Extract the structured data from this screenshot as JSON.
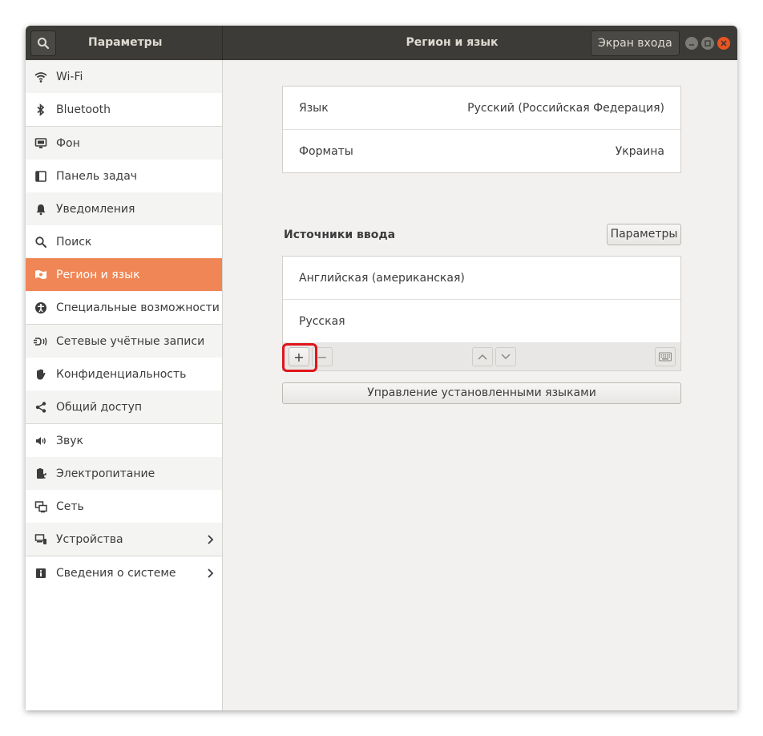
{
  "header": {
    "left_title": "Параметры",
    "center_title": "Регион и язык",
    "login_screen_button": "Экран входа"
  },
  "sidebar": {
    "items": [
      {
        "label": "Wi-Fi",
        "icon": "wifi-icon"
      },
      {
        "label": "Bluetooth",
        "icon": "bluetooth-icon"
      },
      {
        "label": "Фон",
        "icon": "background-icon"
      },
      {
        "label": "Панель задач",
        "icon": "dock-icon"
      },
      {
        "label": "Уведомления",
        "icon": "bell-icon"
      },
      {
        "label": "Поиск",
        "icon": "search-icon"
      },
      {
        "label": "Регион и язык",
        "icon": "region-flag-icon",
        "active": true
      },
      {
        "label": "Специальные возможности",
        "icon": "accessibility-icon"
      },
      {
        "label": "Сетевые учётные записи",
        "icon": "online-accounts-icon"
      },
      {
        "label": "Конфиденциальность",
        "icon": "privacy-hand-icon"
      },
      {
        "label": "Общий доступ",
        "icon": "share-icon"
      },
      {
        "label": "Звук",
        "icon": "speaker-icon"
      },
      {
        "label": "Электропитание",
        "icon": "power-icon"
      },
      {
        "label": "Сеть",
        "icon": "network-icon"
      },
      {
        "label": "Устройства",
        "icon": "devices-icon",
        "has_chevron": true
      },
      {
        "label": "Сведения о системе",
        "icon": "info-icon",
        "has_chevron": true
      }
    ]
  },
  "region": {
    "language_label": "Язык",
    "language_value": "Русский (Российская Федерация)",
    "formats_label": "Форматы",
    "formats_value": "Украина"
  },
  "input_sources": {
    "title": "Источники ввода",
    "options_button": "Параметры",
    "sources": [
      "Английская (американская)",
      "Русская"
    ],
    "add_symbol": "+",
    "remove_symbol": "−"
  },
  "manage_languages_button": "Управление установленными языками",
  "colors": {
    "accent": "#f08656",
    "header_bg": "#3c3b37",
    "close_button": "#e95420",
    "highlight": "#e0151a"
  }
}
